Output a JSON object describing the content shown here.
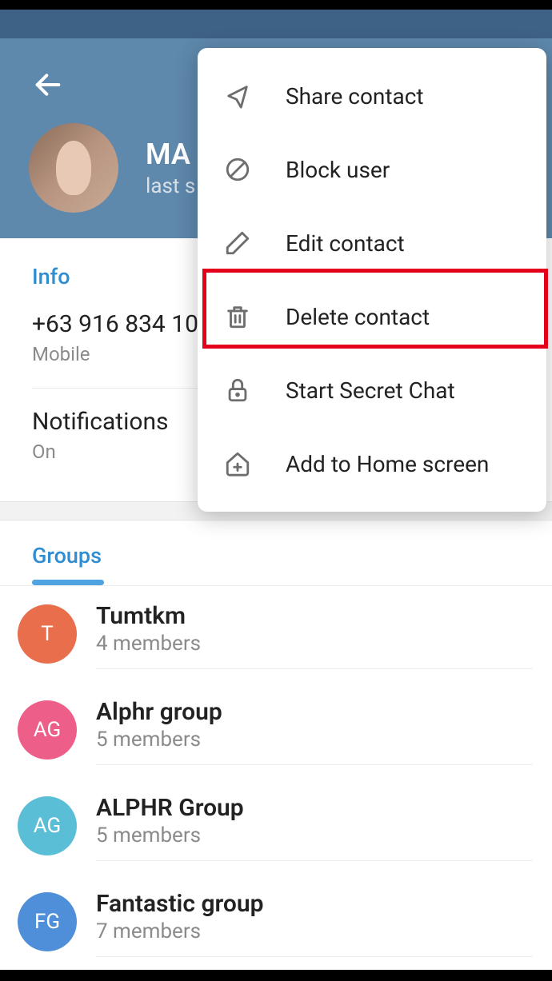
{
  "profile": {
    "name": "MA",
    "status": "last s"
  },
  "sections": {
    "info": {
      "title": "Info",
      "phone": "+63 916 834 10",
      "phone_label": "Mobile",
      "notifications": "Notifications",
      "notif_value": "On"
    },
    "groups": {
      "title": "Groups",
      "items": [
        {
          "initials": "T",
          "name": "Tumtkm",
          "members": "4 members",
          "color": "#e86e4c"
        },
        {
          "initials": "AG",
          "name": "Alphr group",
          "members": "5 members",
          "color": "#ed5f89"
        },
        {
          "initials": "AG",
          "name": "ALPHR Group",
          "members": "5 members",
          "color": "#5abed6"
        },
        {
          "initials": "FG",
          "name": "Fantastic group",
          "members": "7 members",
          "color": "#4f8ed9"
        }
      ]
    }
  },
  "menu": [
    {
      "id": "share",
      "label": "Share contact"
    },
    {
      "id": "block",
      "label": "Block user"
    },
    {
      "id": "edit",
      "label": "Edit contact"
    },
    {
      "id": "delete",
      "label": "Delete contact"
    },
    {
      "id": "secret",
      "label": "Start Secret Chat"
    },
    {
      "id": "home",
      "label": "Add to Home screen"
    }
  ]
}
